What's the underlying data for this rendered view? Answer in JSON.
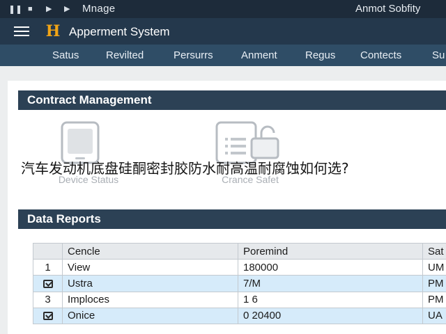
{
  "titlebar": {
    "title": "Mnage",
    "user": "Anmot Sobfity",
    "controls": [
      {
        "icon": "pause-icon",
        "glyph": "❚❚"
      },
      {
        "icon": "stop-icon",
        "glyph": "■"
      },
      {
        "icon": "play-icon",
        "glyph": "▶"
      },
      {
        "icon": "step-forward-icon",
        "glyph": "▶"
      }
    ]
  },
  "app": {
    "title": "Apperment System",
    "logo_letter": "H",
    "logo_color": "#f2a516"
  },
  "nav": {
    "tabs": [
      {
        "label": "Satus"
      },
      {
        "label": "Revilted"
      },
      {
        "label": "Persurrs"
      },
      {
        "label": "Anment"
      },
      {
        "label": "Regus"
      },
      {
        "label": "Contects"
      },
      {
        "label": "Su"
      }
    ]
  },
  "contract": {
    "title": "Contract Management",
    "tiles": [
      {
        "label": "Device Status",
        "icon": "phone-icon"
      },
      {
        "label": "Crance Safet",
        "icon": "document-lock-icon"
      }
    ]
  },
  "overlay_text": "汽车发动机底盘硅酮密封胶防水耐高温耐腐蚀如何选?",
  "reports": {
    "title": "Data Reports",
    "columns": [
      "",
      "Cencle",
      "Poremind",
      "Sat"
    ],
    "rows": [
      {
        "index": "1",
        "checked": false,
        "name": "View",
        "value": "180000",
        "status": "UM"
      },
      {
        "index": "",
        "checked": true,
        "name": "Ustra",
        "value": "7/M",
        "status": "PM"
      },
      {
        "index": "3",
        "checked": false,
        "name": "Imploces",
        "value": "1 6",
        "status": "PM"
      },
      {
        "index": "",
        "checked": true,
        "name": "Onice",
        "value": "0 20400",
        "status": "UA"
      }
    ]
  },
  "colors": {
    "titlebar": "#1d2b3a",
    "appbar": "#24384c",
    "nav": "#2f4d66",
    "section_header": "#2c4155",
    "row_highlight": "#d6ebfa"
  }
}
